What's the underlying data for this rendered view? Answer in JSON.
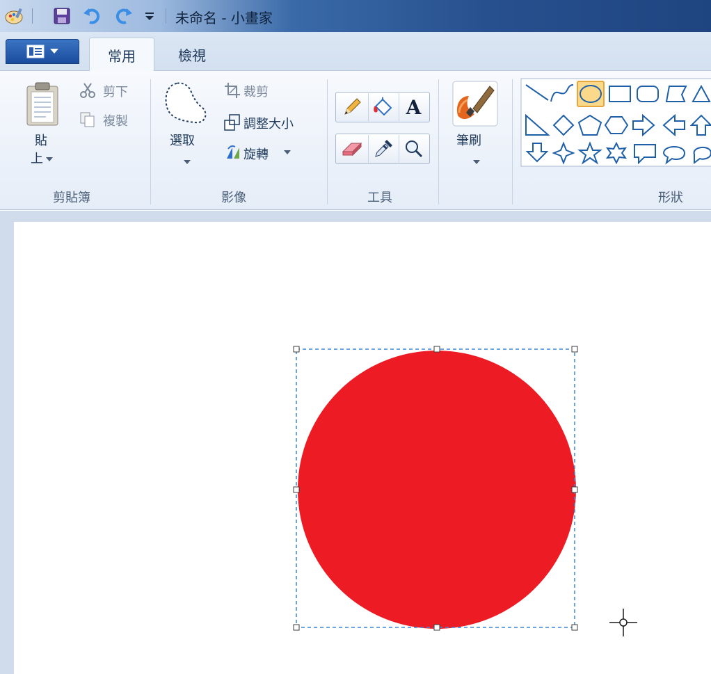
{
  "window": {
    "title": "未命名 - 小畫家"
  },
  "quick_access": {
    "icons": [
      "paint-app-icon",
      "save-icon",
      "undo-icon",
      "redo-icon",
      "customize-dropdown-icon"
    ]
  },
  "tabs": [
    {
      "label": "常用",
      "active": true
    },
    {
      "label": "檢視",
      "active": false
    }
  ],
  "clipboard": {
    "paste_label_top": "貼",
    "paste_label_bottom": "上",
    "cut_label": "剪下",
    "copy_label": "複製",
    "group_label": "剪貼簿"
  },
  "image": {
    "select_label": "選取",
    "crop_label": "裁剪",
    "resize_label": "調整大小",
    "rotate_label": "旋轉",
    "group_label": "影像"
  },
  "tools": {
    "items": [
      "pencil-icon",
      "fill-icon",
      "text-icon",
      "eraser-icon",
      "color-picker-icon",
      "magnifier-icon"
    ],
    "text_glyph": "A",
    "group_label": "工具"
  },
  "brushes": {
    "label": "筆刷"
  },
  "shapes": {
    "group_label": "形狀",
    "selected": "oval"
  },
  "colors": {
    "shape_fill": "#ed1c24",
    "selection_border": "#3b86d6",
    "titlebar_dark": "#1f4580",
    "accent": "#3c74c4"
  }
}
